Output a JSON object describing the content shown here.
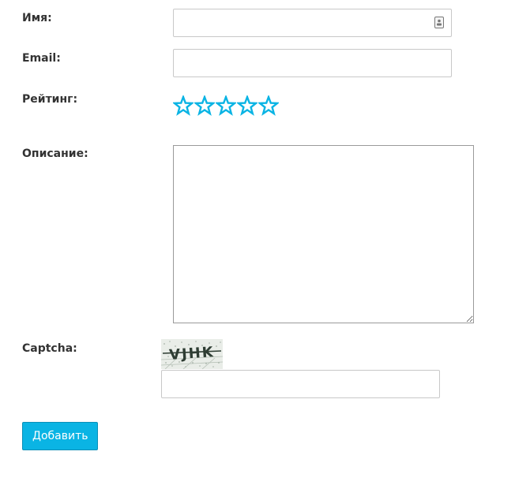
{
  "form": {
    "name_label": "Имя:",
    "name_value": "",
    "name_placeholder": "",
    "name_field_icon": "contact-card-icon",
    "email_label": "Email:",
    "email_value": "",
    "email_placeholder": "",
    "rating_label": "Рейтинг:",
    "rating": {
      "max": 5,
      "selected": 0,
      "star_icon": "star-outline-icon",
      "color": "#0ab4e4"
    },
    "description_label": "Описание:",
    "description_value": "",
    "captcha_label": "Captcha:",
    "captcha_image_text": "VJHK",
    "captcha_value": "",
    "submit_label": "Добавить"
  },
  "colors": {
    "accent": "#0ab4e4",
    "input_border": "#c8c8c8",
    "label_text": "#333333"
  }
}
